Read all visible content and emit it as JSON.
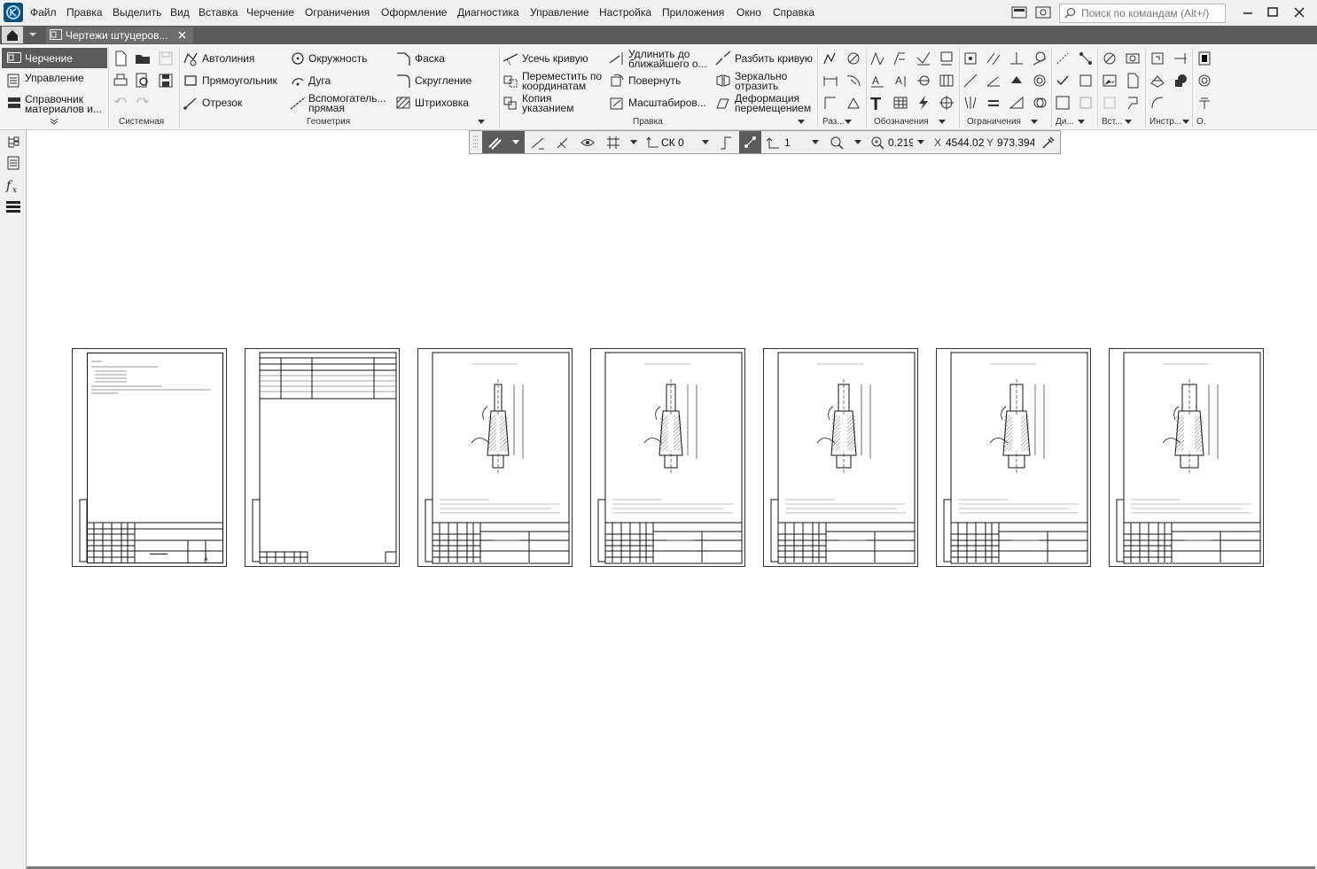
{
  "menu": {
    "items": [
      "Файл",
      "Правка",
      "Выделить",
      "Вид",
      "Вставка",
      "Черчение",
      "Ограничения",
      "Оформление",
      "Диагностика",
      "Управление",
      "Настройка",
      "Приложения",
      "Окно",
      "Справка"
    ],
    "search_placeholder": "Поиск по командам (Alt+/)"
  },
  "tab": {
    "title": "Чертежи штуцеров..."
  },
  "ribbon": {
    "left_panel": [
      "Черчение",
      "Управление",
      "Справочник материалов и..."
    ],
    "geometry": {
      "autoline": "Автолиния",
      "rectangle": "Прямоугольник",
      "segment": "Отрезок",
      "circle": "Окружность",
      "arc": "Дуга",
      "aux_line": "Вспомогатель... прямая",
      "chamfer": "Фаска",
      "fillet": "Скругление",
      "hatch": "Штриховка"
    },
    "edit": {
      "trim": "Усечь кривую",
      "move_coords": "Переместить по координатам",
      "copy_pointer": "Копия указанием",
      "extend": "Удлинить до ближайшего о...",
      "rotate": "Повернуть",
      "scale": "Масштабиров...",
      "split": "Разбить кривую",
      "mirror": "Зеркально отразить",
      "deform": "Деформация перемещением"
    },
    "groups": {
      "system": "Системная",
      "geometry": "Геометрия",
      "edit": "Правка",
      "dims": "Раз...",
      "notations": "Обозначения",
      "constraints": "Ограничения",
      "diag": "Ди...",
      "insert": "Вст...",
      "tools": "Инстр...",
      "o": "О."
    }
  },
  "float_toolbar": {
    "cs": "СК 0",
    "step": "1",
    "zoom": "0.219",
    "x_label": "X",
    "x_value": "4544.026",
    "y_label": "Y",
    "y_value": "973.3946"
  },
  "sheets_count": 7
}
